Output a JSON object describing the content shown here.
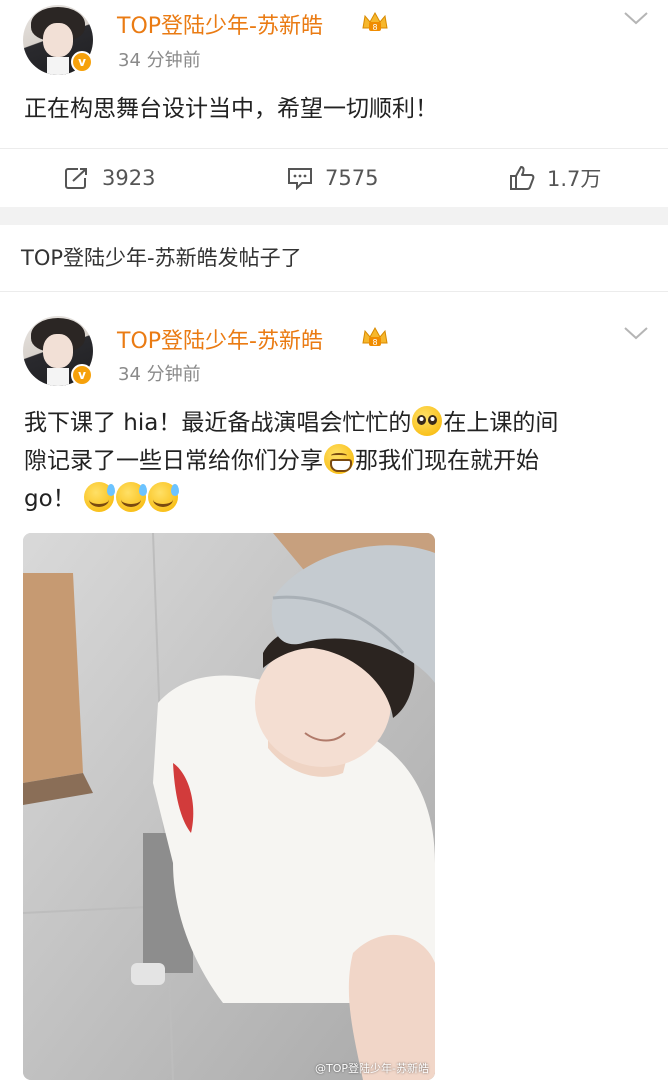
{
  "post1": {
    "username": "TOP登陆少年-苏新皓",
    "time": "34 分钟前",
    "text": "正在构思舞台设计当中，希望一切顺利！",
    "actions": {
      "repost_count": "3923",
      "comment_count": "7575",
      "like_count": "1.7万"
    }
  },
  "section": {
    "title": "TOP登陆少年-苏新皓发帖子了"
  },
  "post2": {
    "username": "TOP登陆少年-苏新皓",
    "time": "34 分钟前",
    "text_line1_a": "我下课了 hia！最近备战演唱会忙忙的",
    "text_line1_b": "在上课的间",
    "text_line2_a": "隙记录了一些日常给你们分享",
    "text_line2_b": "那我们现在就开始",
    "text_line3": "go！",
    "photo_watermark": "@TOP登陆少年-苏新皓"
  },
  "colors": {
    "username": "#ea7b13",
    "badge": "#f6a10b",
    "separator": "#f2f2f2"
  },
  "icons": {
    "repost": "share-icon",
    "comment": "comment-icon",
    "like": "thumbs-up-icon",
    "verified": "verified-badge-icon",
    "crown": "crown-icon",
    "more": "chevron-down-icon"
  }
}
